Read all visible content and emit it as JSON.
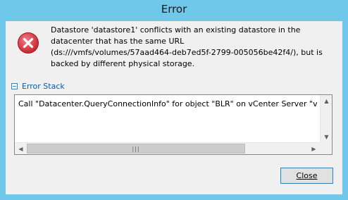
{
  "window": {
    "title": "Error"
  },
  "message": {
    "lines": [
      "Datastore 'datastore1' conflicts with an existing datastore in the",
      "datacenter that has the same URL",
      "(ds:///vmfs/volumes/57aad464-deb7ed5f-2799-005056be42f4/), but is",
      "backed by different physical storage."
    ],
    "icon": "error-icon"
  },
  "error_stack": {
    "label": "Error Stack",
    "text": "Call \"Datacenter.QueryConnectionInfo\" for object \"BLR\" on vCenter Server \"vcsa"
  },
  "buttons": {
    "close_label": "Close"
  },
  "colors": {
    "title_bar": "#6fc7e9",
    "client_bg": "#f0f0f0",
    "link_blue": "#0c58a8",
    "error_red": "#d9303c"
  }
}
